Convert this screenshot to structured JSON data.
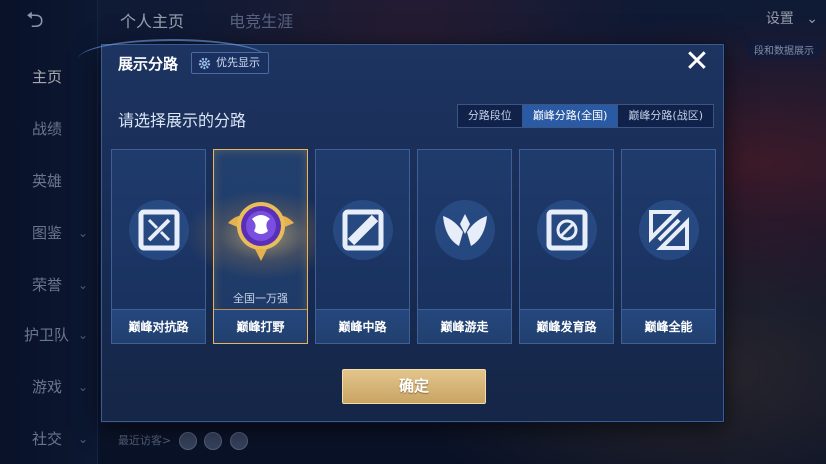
{
  "background": {
    "back_icon": "back-arrow-icon",
    "nav": [
      {
        "label": "主页",
        "active": true
      },
      {
        "label": "战绩"
      },
      {
        "label": "英雄"
      },
      {
        "label": "图鉴"
      },
      {
        "label": "荣誉"
      },
      {
        "label": "护卫队"
      },
      {
        "label": "游戏"
      },
      {
        "label": "社交"
      }
    ],
    "top_tabs": [
      "个人主页",
      "电竞生涯"
    ],
    "settings_label": "设置",
    "badge_text": "段和数据展示",
    "visitors_label": "最近访客>"
  },
  "dialog": {
    "title": "展示分路",
    "priority_button": "优先显示",
    "close_icon": "close-icon",
    "subtitle": "请选择展示的分路",
    "segments": [
      {
        "label": "分路段位",
        "active": false
      },
      {
        "label": "巅峰分路(全国)",
        "active": true
      },
      {
        "label": "巅峰分路(战区)",
        "active": false
      }
    ],
    "cards": [
      {
        "label": "巅峰对抗路",
        "icon": "clash-lane-icon",
        "selected": false,
        "rank": ""
      },
      {
        "label": "巅峰打野",
        "icon": "jungle-emblem-icon",
        "selected": true,
        "rank": "全国一万强"
      },
      {
        "label": "巅峰中路",
        "icon": "mid-lane-icon",
        "selected": false,
        "rank": ""
      },
      {
        "label": "巅峰游走",
        "icon": "roam-icon",
        "selected": false,
        "rank": ""
      },
      {
        "label": "巅峰发育路",
        "icon": "farm-lane-icon",
        "selected": false,
        "rank": ""
      },
      {
        "label": "巅峰全能",
        "icon": "all-round-icon",
        "selected": false,
        "rank": ""
      }
    ],
    "confirm_label": "确定"
  },
  "colors": {
    "dialog_bg": "#1d3461",
    "accent_blue": "#2a5aa3",
    "gold": "#e9b45a",
    "confirm_gold": "#d9b97a"
  }
}
